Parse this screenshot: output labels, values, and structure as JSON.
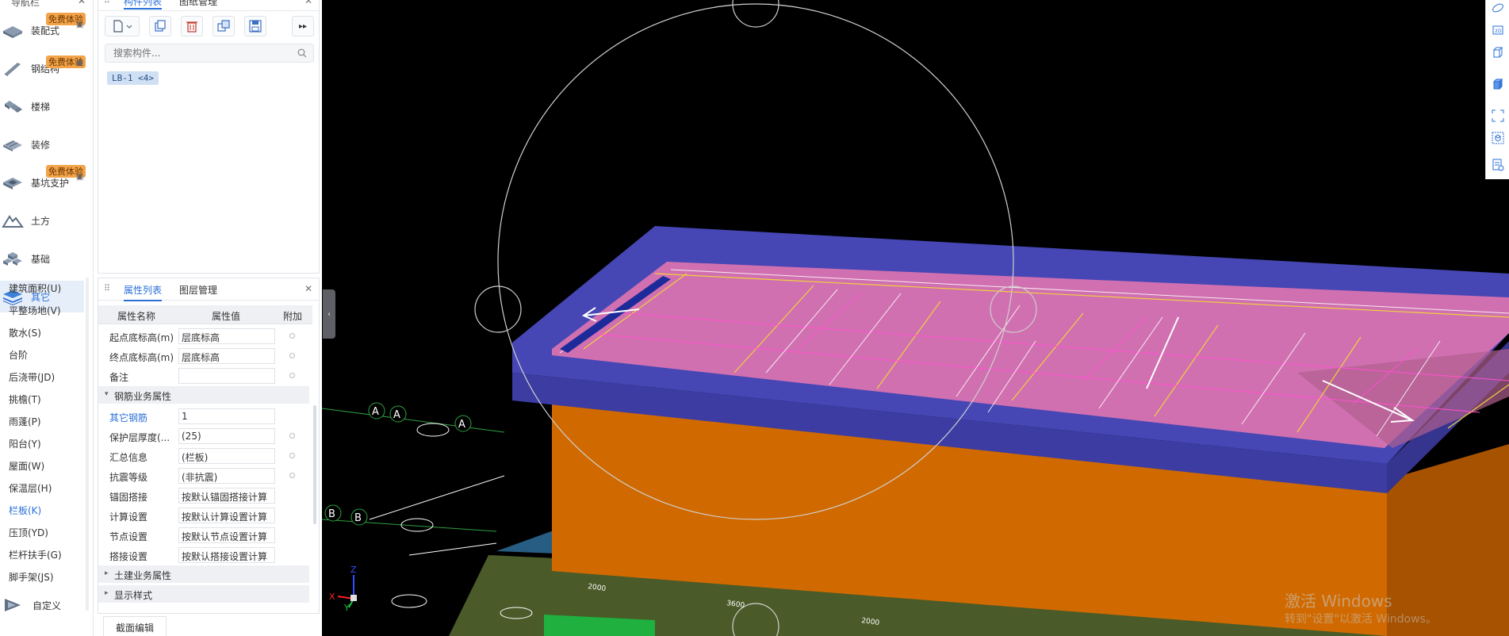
{
  "leftnav": {
    "title": "导航栏",
    "categories": [
      {
        "label": "装配式",
        "badge": "免费体验",
        "icon": "prefab-icon"
      },
      {
        "label": "钢结构",
        "badge": "免费体验",
        "icon": "steel-icon"
      },
      {
        "label": "楼梯",
        "badge": "",
        "icon": "stairs-icon"
      },
      {
        "label": "装修",
        "badge": "",
        "icon": "decoration-icon"
      },
      {
        "label": "基坑支护",
        "badge": "免费体验",
        "icon": "pit-support-icon"
      },
      {
        "label": "土方",
        "badge": "",
        "icon": "earthwork-icon"
      },
      {
        "label": "基础",
        "badge": "",
        "icon": "foundation-icon"
      },
      {
        "label": "其它",
        "badge": "",
        "icon": "other-layers-icon"
      }
    ],
    "subitems": [
      "建筑面积(U)",
      "平整场地(V)",
      "散水(S)",
      "台阶",
      "后浇带(JD)",
      "挑檐(T)",
      "雨蓬(P)",
      "阳台(Y)",
      "屋面(W)",
      "保温层(H)",
      "栏板(K)",
      "压顶(YD)",
      "栏杆扶手(G)",
      "脚手架(JS)"
    ],
    "active_subitem": "栏板(K)",
    "custom_label": "自定义"
  },
  "component_panel": {
    "tabs": [
      "构件列表",
      "图纸管理"
    ],
    "search_placeholder": "搜索构件...",
    "items": [
      "LB-1 <4>"
    ]
  },
  "property_panel": {
    "tabs": [
      "属性列表",
      "图层管理"
    ],
    "headers": {
      "name": "属性名称",
      "value": "属性值",
      "extra": "附加"
    },
    "rows": [
      {
        "name": "起点底标高(m)",
        "value": "层底标高",
        "highlight": false
      },
      {
        "name": "终点底标高(m)",
        "value": "层底标高",
        "highlight": false
      },
      {
        "name": "备注",
        "value": "",
        "highlight": false
      }
    ],
    "rebar_group": "钢筋业务属性",
    "rebar_rows": [
      {
        "name": "其它钢筋",
        "value": "1",
        "highlight": true
      },
      {
        "name": "保护层厚度(...",
        "value": "(25)",
        "highlight": false
      },
      {
        "name": "汇总信息",
        "value": "(栏板)",
        "highlight": false
      },
      {
        "name": "抗震等级",
        "value": "(非抗震)",
        "highlight": false
      },
      {
        "name": "锚固搭接",
        "value": "按默认锚固搭接计算",
        "highlight": false
      },
      {
        "name": "计算设置",
        "value": "按默认计算设置计算",
        "highlight": false
      },
      {
        "name": "节点设置",
        "value": "按默认节点设置计算",
        "highlight": false
      },
      {
        "name": "搭接设置",
        "value": "按默认搭接设置计算",
        "highlight": false
      }
    ],
    "civil_group": "土建业务属性",
    "display_group": "显示样式",
    "bottom_tab": "截面编辑"
  },
  "viewport": {
    "axis_labels": [
      "A",
      "A",
      "A",
      "B",
      "B"
    ],
    "dim_labels": [
      "2000",
      "3600",
      "2000"
    ],
    "axis_x": "X",
    "axis_y": "Y",
    "axis_z": "Z"
  },
  "watermark": {
    "line1": "激活 Windows",
    "line2": "转到\"设置\"以激活 Windows。"
  },
  "colors": {
    "accent": "#2a6fd8",
    "slab_blue": "#4646b4",
    "wall_orange": "#d06a00",
    "slab_pink": "#d070b0"
  }
}
